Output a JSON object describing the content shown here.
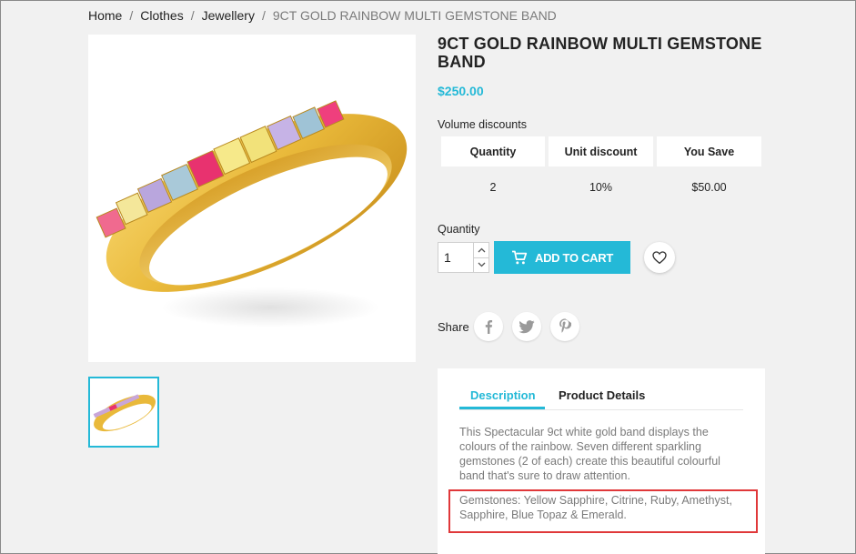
{
  "breadcrumb": {
    "items": [
      "Home",
      "Clothes",
      "Jewellery"
    ],
    "separator": "/",
    "current": "9CT GOLD RAINBOW MULTI GEMSTONE BAND"
  },
  "product": {
    "title_line1": "9CT GOLD RAINBOW MULTI GEMSTONE",
    "title_line2": "BAND",
    "price": "$250.00"
  },
  "volume_discounts": {
    "title": "Volume discounts",
    "headers": [
      "Quantity",
      "Unit discount",
      "You Save"
    ],
    "rows": [
      [
        "2",
        "10%",
        "$50.00"
      ]
    ]
  },
  "cart": {
    "quantity_label": "Quantity",
    "quantity_value": "1",
    "add_to_cart_label": "ADD TO CART"
  },
  "share": {
    "label": "Share",
    "icons": [
      "facebook-icon",
      "twitter-icon",
      "pinterest-icon"
    ]
  },
  "tabs": {
    "items": [
      "Description",
      "Product Details"
    ],
    "active": "Description"
  },
  "description": {
    "paragraph_lines": [
      "This Spectacular 9ct white gold band displays the",
      "colours of the rainbow. Seven different sparkling",
      "gemstones (2 of each) create this beautiful colourful",
      "band that's sure to draw attention."
    ],
    "gemstones_lines": [
      "Gemstones: Yellow Sapphire, Citrine, Ruby, Amethyst,",
      "Sapphire, Blue Topaz & Emerald."
    ]
  },
  "colors": {
    "accent": "#24b9d7",
    "highlight_border": "#e0383a",
    "background": "#f1f1f1"
  }
}
